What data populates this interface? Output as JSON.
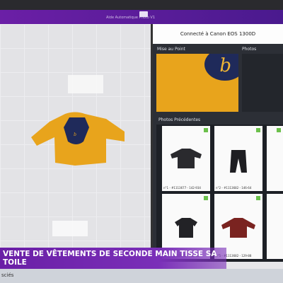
{
  "window": {
    "title": "Aide Automatique Photo V1"
  },
  "camera": {
    "status": "Connecté à Canon EOS 1300D"
  },
  "labels": {
    "focus": "Mise au Point",
    "photos": "Photos",
    "previous": "Photos Précédentes"
  },
  "focus_logo": "b",
  "thumbnails": [
    {
      "caption": "n°1 - #1113677 - 142-934",
      "item": "long-sleeve-top",
      "color": "#2a2a2e"
    },
    {
      "caption": "n°2 - #1113682 - 146-64",
      "item": "trousers",
      "color": "#1e1e22"
    },
    {
      "caption": "n°4 - #1113672 - 146-64",
      "item": "tshirt",
      "color": "#222226"
    },
    {
      "caption": "n°5 - #1113682 - 129-88",
      "item": "long-sleeve-top",
      "color": "#7a2320"
    }
  ],
  "banner": {
    "text": "VENTE DE VÊTEMENTS DE SECONDE MAIN TISSE SA TOILE"
  },
  "subtitle": {
    "text": "sciés"
  },
  "colors": {
    "accent": "#6b1fa6",
    "panel": "#2c2f36",
    "shirt": "#e8a41c",
    "print": "#1f2a5a"
  }
}
